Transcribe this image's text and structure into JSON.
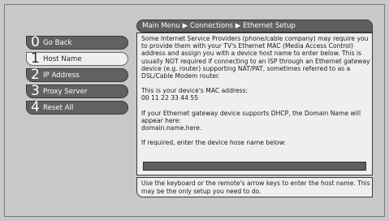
{
  "breadcrumb": "Main Menu ▶ Connections ▶ Ethernet Setup",
  "menu": [
    {
      "number": "0",
      "label": "Go Back",
      "selected": false
    },
    {
      "number": "1",
      "label": "Host Name",
      "selected": true
    },
    {
      "number": "2",
      "label": "IP Address",
      "selected": false
    },
    {
      "number": "3",
      "label": "Proxy Server",
      "selected": false
    },
    {
      "number": "4",
      "label": "Reset All",
      "selected": false
    }
  ],
  "info": {
    "paragraph1": "Some Internet Service Providers (phone/cable company) may require you to provide them with your TV's Ethernet MAC (Media Access Control) address and assign you with a device host name to enter below. This is usually NOT required if connecting to an ISP through an Ethernet gateway device (e.g. router) supporting NAT/PAT, sometimes referred to as a DSL/Cable Modem router.",
    "mac_label": "This is your device's MAC address:",
    "mac_value": "00 11 22 33 44 55",
    "dhcp_label": "If your Ethernet gateway device supports DHCP, the Domain Name will appear here:",
    "domain_value": "domain.name.here.",
    "host_prompt": "If required, enter the device hose name below:"
  },
  "hostname_input": {
    "value": ""
  },
  "help": "Use the keyboard or the remote's arrow keys to enter the host name. This may be the only setup you need to do."
}
